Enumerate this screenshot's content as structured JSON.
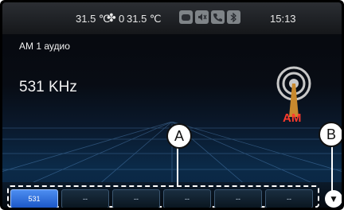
{
  "status": {
    "temp_left": "31.5 ℃",
    "fan_level": "0",
    "temp_right": "31.5 ℃",
    "time": "15:13",
    "icons": [
      "message-icon",
      "mute-icon",
      "phone-icon",
      "bluetooth-icon"
    ]
  },
  "source": {
    "title": "AM 1 аудио",
    "frequency": "531 KHz",
    "band_label": "AM"
  },
  "callouts": {
    "a": "A",
    "b": "B"
  },
  "presets": [
    {
      "label": "531",
      "active": true
    },
    {
      "label": "--",
      "active": false
    },
    {
      "label": "--",
      "active": false
    },
    {
      "label": "--",
      "active": false
    },
    {
      "label": "--",
      "active": false
    },
    {
      "label": "--",
      "active": false
    }
  ],
  "colors": {
    "accent_red": "#ff3a2c",
    "preset_active": "#2f72e0",
    "background": "#000000"
  }
}
